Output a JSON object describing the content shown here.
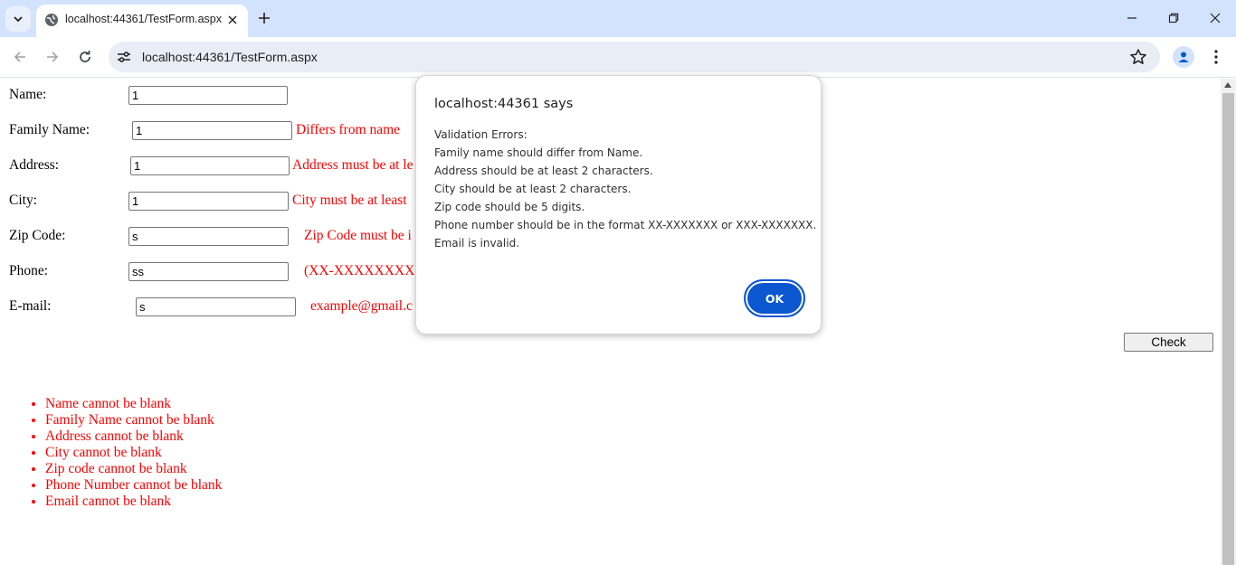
{
  "browser": {
    "tab_title": "localhost:44361/TestForm.aspx",
    "url": "localhost:44361/TestForm.aspx"
  },
  "form": {
    "name_label": "Name:",
    "name_value": "1",
    "family_label": "Family Name:",
    "family_value": "1",
    "family_error": "Differs from name",
    "address_label": "Address:",
    "address_value": "1",
    "address_error": "Address must be at le",
    "city_label": "City:",
    "city_value": "1",
    "city_error": "City must be at least",
    "zip_label": "Zip Code:",
    "zip_value": "s",
    "zip_error": "Zip Code must be i",
    "phone_label": "Phone:",
    "phone_value": "ss",
    "phone_error": "(XX-XXXXXXXX",
    "email_label": "E-mail:",
    "email_value": "s",
    "email_error": "example@gmail.c",
    "check_label": "Check"
  },
  "summary": [
    "Name cannot be blank",
    "Family Name cannot be blank",
    "Address cannot be blank",
    "City cannot be blank",
    "Zip code cannot be blank",
    "Phone Number cannot be blank",
    "Email cannot be blank"
  ],
  "dialog": {
    "title": "localhost:44361 says",
    "lines": [
      "Validation Errors:",
      "Family name should differ from Name.",
      "Address should be at least 2 characters.",
      "City should be at least 2 characters.",
      "Zip code should be 5 digits.",
      "Phone number should be in the format XX-XXXXXXX or XXX-XXXXXXX.",
      "Email is invalid."
    ],
    "ok_label": "OK"
  },
  "colors": {
    "error": "#ff0000",
    "accent": "#0b57d0",
    "tabstrip": "#d3e3fd"
  }
}
